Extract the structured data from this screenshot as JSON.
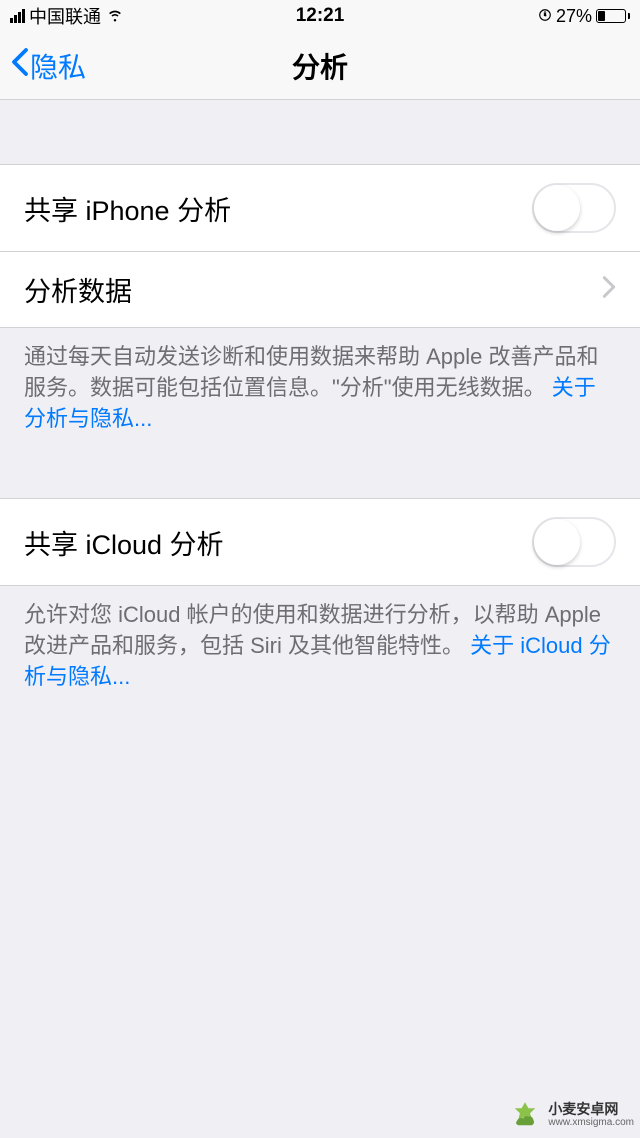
{
  "statusBar": {
    "carrier": "中国联通",
    "time": "12:21",
    "batteryPercent": "27%"
  },
  "nav": {
    "back": "隐私",
    "title": "分析"
  },
  "group1": {
    "row1": {
      "label": "共享 iPhone 分析"
    },
    "row2": {
      "label": "分析数据"
    },
    "footer": {
      "text": "通过每天自动发送诊断和使用数据来帮助 Apple 改善产品和服务。数据可能包括位置信息。\"分析\"使用无线数据。",
      "link": "关于分析与隐私..."
    }
  },
  "group2": {
    "row1": {
      "label": "共享 iCloud 分析"
    },
    "footer": {
      "text": "允许对您 iCloud 帐户的使用和数据进行分析，以帮助 Apple 改进产品和服务，包括 Siri 及其他智能特性。",
      "link": "关于 iCloud 分析与隐私..."
    }
  },
  "watermark": {
    "name": "小麦安卓网",
    "url": "www.xmsigma.com"
  }
}
